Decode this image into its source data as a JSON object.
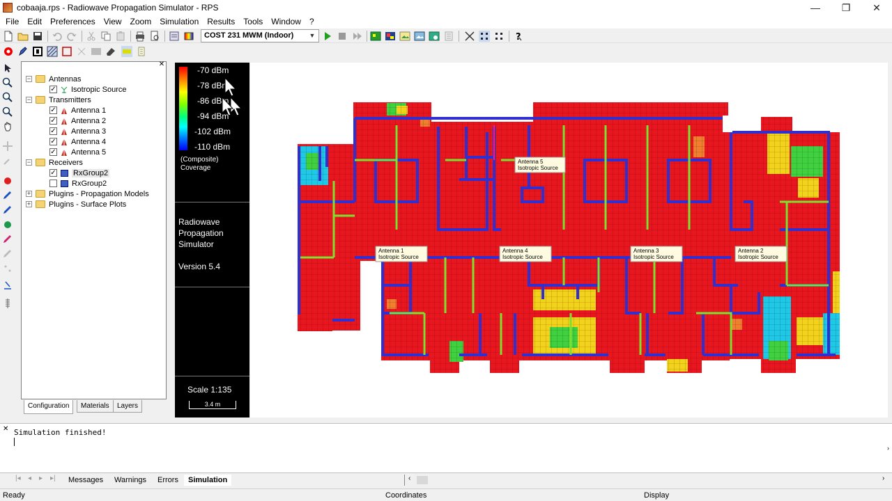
{
  "window": {
    "title": "cobaaja.rps - Radiowave Propagation Simulator - RPS",
    "min_glyph": "—",
    "restore_glyph": "❐",
    "close_glyph": "✕"
  },
  "menu": [
    "File",
    "Edit",
    "Preferences",
    "View",
    "Zoom",
    "Simulation",
    "Results",
    "Tools",
    "Window",
    "?"
  ],
  "toolbar": {
    "model_select": "COST 231 MWM (Indoor)"
  },
  "tree": {
    "antennas": "Antennas",
    "isotropic": "Isotropic Source",
    "transmitters": "Transmitters",
    "tx": [
      "Antenna 1",
      "Antenna 2",
      "Antenna 3",
      "Antenna 4",
      "Antenna 5"
    ],
    "receivers": "Receivers",
    "rx": [
      "RxGroup2",
      "RxGroup2"
    ],
    "plugins_prop": "Plugins - Propagation Models",
    "plugins_surface": "Plugins - Surface Plots"
  },
  "panel_tabs": [
    "Configuration",
    "Materials",
    "Layers"
  ],
  "legend": {
    "levels": [
      "-70 dBm",
      "-78 dBm",
      "-86 dBm",
      "-94 dBm",
      "-102 dBm",
      "-110 dBm"
    ],
    "mode1": "(Composite)",
    "mode2": "Coverage",
    "app_line1": "Radiowave",
    "app_line2": "Propagation",
    "app_line3": "Simulator",
    "version": "Version 5.4",
    "scale": "Scale 1:135",
    "scale_bar": "3.4 m"
  },
  "map_labels": [
    {
      "name": "Antenna 5",
      "type": "Isotropic Source"
    },
    {
      "name": "Antenna 1",
      "type": "Isotropic Source"
    },
    {
      "name": "Antenna 4",
      "type": "Isotropic Source"
    },
    {
      "name": "Antenna 3",
      "type": "Isotropic Source"
    },
    {
      "name": "Antenna 2",
      "type": "Isotropic Source"
    }
  ],
  "output": {
    "message": "Simulation finished!",
    "tabs": [
      "Messages",
      "Warnings",
      "Errors",
      "Simulation"
    ]
  },
  "status": {
    "ready": "Ready",
    "coordinates": "Coordinates",
    "display": "Display"
  },
  "colors": {
    "coverage_red": "#e8161e",
    "wall_blue": "#3030d0",
    "door_green": "#80e030"
  }
}
